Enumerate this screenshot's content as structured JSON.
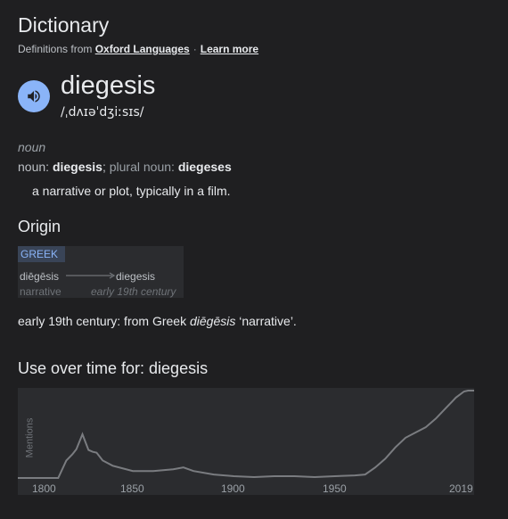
{
  "panel": {
    "title": "Dictionary",
    "source_prefix": "Definitions from",
    "source_link": "Oxford Languages",
    "learn_more": "Learn more"
  },
  "entry": {
    "word": "diegesis",
    "phonetic": "/ˌdʌɪəˈdʒiːsɪs/",
    "part_of_speech": "noun",
    "forms_prefix": "noun:",
    "forms_word": "diegesis",
    "forms_sep": ";",
    "plural_label": "plural noun:",
    "plural_word": "diegeses",
    "definition": "a narrative or plot, typically in a film."
  },
  "origin": {
    "heading": "Origin",
    "language": "GREEK",
    "source_word": "diēgēsis",
    "source_gloss": "narrative",
    "target_word": "diegesis",
    "target_date": "early 19th century",
    "text_before": "early 19th century: from Greek ",
    "text_italic": "diēgēsis",
    "text_after": " ‘narrative’."
  },
  "usage": {
    "heading": "Use over time for: diegesis",
    "ylabel": "Mentions",
    "ticks": [
      "1800",
      "1850",
      "1900",
      "1950",
      "2019"
    ]
  },
  "colors": {
    "accent": "#8ab4f8",
    "background": "#1f1f21",
    "card": "#2b2c2f",
    "line": "#7a7c80"
  },
  "icons": {
    "speaker": "volume-icon",
    "arrow": "arrow-right-icon"
  },
  "chart_data": {
    "type": "area",
    "xlabel": "",
    "ylabel": "Mentions",
    "xlim": [
      1793,
      2019
    ],
    "ylim": [
      0,
      100
    ],
    "x": [
      1793,
      1807,
      1813,
      1817,
      1820,
      1822,
      1825,
      1828,
      1830,
      1832,
      1835,
      1840,
      1850,
      1860,
      1870,
      1875,
      1880,
      1890,
      1900,
      1910,
      1920,
      1930,
      1940,
      1950,
      1960,
      1965,
      1970,
      1975,
      1980,
      1985,
      1990,
      1995,
      2000,
      2005,
      2010,
      2014,
      2016,
      2019
    ],
    "y": [
      0,
      0,
      0,
      20,
      27,
      33,
      50,
      32,
      30,
      29,
      20,
      14,
      8,
      8,
      10,
      12,
      8,
      4,
      2,
      1,
      2,
      2,
      1,
      2,
      3,
      4,
      12,
      22,
      35,
      46,
      52,
      58,
      68,
      80,
      92,
      99,
      100,
      100
    ]
  }
}
